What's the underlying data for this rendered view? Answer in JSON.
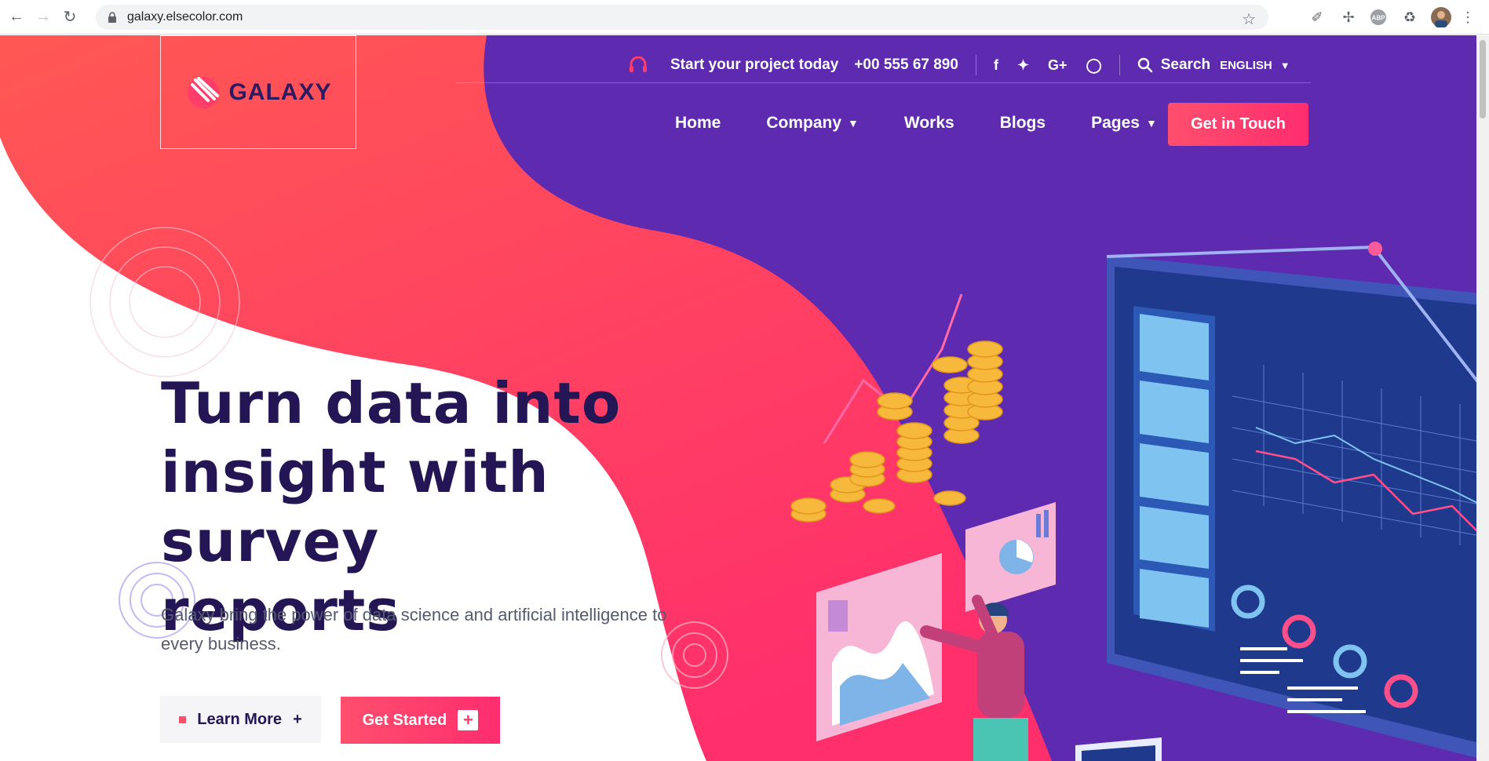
{
  "browser": {
    "url": "galaxy.elsecolor.com",
    "back_icon": "arrow-left-icon",
    "forward_icon": "arrow-right-icon",
    "reload_icon": "reload-icon"
  },
  "header": {
    "logo_text": "GALAXY",
    "topbar": {
      "tagline": "Start your project today",
      "phone": "+00 555 67 890",
      "social": [
        "f",
        "t",
        "G+",
        "ig"
      ],
      "search_label": "Search",
      "language": "ENGLISH"
    },
    "nav": [
      {
        "label": "Home",
        "dropdown": false
      },
      {
        "label": "Company",
        "dropdown": true
      },
      {
        "label": "Works",
        "dropdown": false
      },
      {
        "label": "Blogs",
        "dropdown": false
      },
      {
        "label": "Pages",
        "dropdown": true
      }
    ],
    "cta_label": "Get in Touch"
  },
  "hero": {
    "title_line1": "Turn data into",
    "title_line2": "insight with survey",
    "title_line3": "reports",
    "subtitle_line1": "Galaxy bring the power of data science and artificial intelligence to",
    "subtitle_line2": "every business.",
    "learn_more": "Learn More",
    "get_started": "Get Started"
  },
  "colors": {
    "coral": "#ff5457",
    "pink": "#ff2d6f",
    "purple": "#5e2ab0",
    "navy": "#241655"
  }
}
